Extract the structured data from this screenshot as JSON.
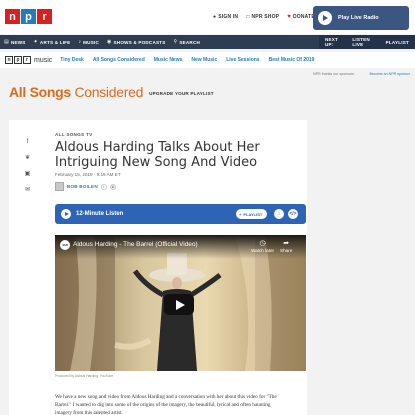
{
  "header": {
    "logo": [
      "n",
      "p",
      "r"
    ],
    "links": [
      {
        "icon": "user-icon",
        "label": "SIGN IN"
      },
      {
        "icon": "bag-icon",
        "label": "NPR SHOP"
      },
      {
        "icon": "heart-icon",
        "label": "DONATE"
      }
    ],
    "live_radio_label": "Play Live Radio"
  },
  "navbar": {
    "items": [
      "NEWS",
      "ARTS & LIFE",
      "MUSIC",
      "SHOWS & PODCASTS",
      "SEARCH"
    ],
    "right_items": [
      "NEXT UP:",
      "LISTEN LIVE",
      "PLAYLIST"
    ]
  },
  "subnav": {
    "music_word": "music",
    "links": [
      "Tiny Desk",
      "All Songs Considered",
      "Music News",
      "New Music",
      "Live Sessions",
      "Best Music Of 2019"
    ]
  },
  "banner": {
    "title_bold": "All Songs",
    "title_light": " Considered",
    "upgrade": "UPGRADE YOUR PLAYLIST"
  },
  "side": {
    "left": "NPR thanks our sponsors",
    "right": "Become an NPR sponsor"
  },
  "article": {
    "eyebrow": "ALL SONGS TV",
    "title": "Aldous Harding Talks About Her Intriguing New Song And Video",
    "date": "February 15, 2019 · 9:19 AM ET",
    "author": "BOB BOILEN",
    "listen_label": "12-Minute Listen",
    "playlist_label": "PLAYLIST",
    "video": {
      "title": "Aldous Harding - The Barrel (Official Video)",
      "channel": "4AD",
      "watch_later": "Watch later",
      "share": "Share"
    },
    "caption": "Produced by Aldous Harding, YouTube",
    "body": "We have a new song and video from Aldous Harding and a conversation with her about this video for \"The Barrel.\" I wanted to dig into some of the origins of the imagery, the beautiful, lyrical and often haunting imagery from this talented artist."
  }
}
